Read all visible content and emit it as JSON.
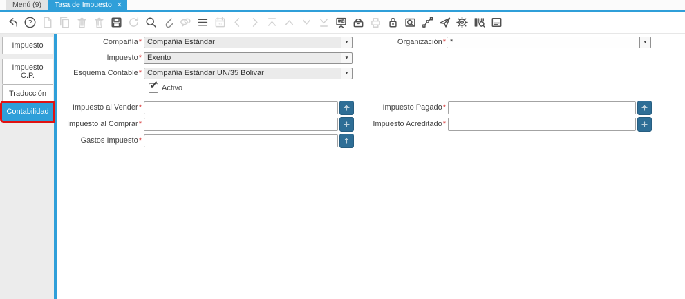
{
  "window": {
    "tab_menu": "Menú (9)",
    "tab_active": "Tasa de Impuesto"
  },
  "ui": {
    "close_glyph": "✕",
    "dropdown_arrow": "▼",
    "required_mark": "*",
    "check_glyph": "✓"
  },
  "colors": {
    "accent_blue": "#2f9fd9",
    "highlight_red": "#e01212",
    "account_button_blue": "#2e6e96",
    "readonly_field_gray": "#ebebeb"
  },
  "toolbar": {
    "items": [
      {
        "name": "undo-icon",
        "icon": "undo",
        "tone": "dk"
      },
      {
        "name": "help-icon",
        "icon": "help",
        "tone": "dk"
      },
      {
        "name": "new-record-icon",
        "icon": "newdoc",
        "tone": "lt"
      },
      {
        "name": "copy-record-icon",
        "icon": "copy",
        "tone": "lt"
      },
      {
        "name": "delete-record-icon",
        "icon": "trash",
        "tone": "lt"
      },
      {
        "name": "delete-selection-icon",
        "icon": "trash",
        "tone": "lt"
      },
      {
        "name": "save-icon",
        "icon": "save",
        "tone": "dk"
      },
      {
        "name": "refresh-icon",
        "icon": "refresh",
        "tone": "lt"
      },
      {
        "name": "find-icon",
        "icon": "find",
        "tone": "dk"
      },
      {
        "name": "attachment-icon",
        "icon": "attach",
        "tone": "md"
      },
      {
        "name": "chat-icon",
        "icon": "chat",
        "tone": "lt"
      },
      {
        "name": "grid-toggle-icon",
        "icon": "lines",
        "tone": "dk"
      },
      {
        "name": "calendar-icon",
        "icon": "calendar",
        "tone": "lt"
      },
      {
        "name": "previous-record-icon",
        "icon": "prev",
        "tone": "lt"
      },
      {
        "name": "next-record-icon",
        "icon": "next",
        "tone": "lt"
      },
      {
        "name": "first-record-icon",
        "icon": "first",
        "tone": "lt"
      },
      {
        "name": "parent-record-icon",
        "icon": "up",
        "tone": "lt"
      },
      {
        "name": "detail-record-icon",
        "icon": "down",
        "tone": "lt"
      },
      {
        "name": "last-record-icon",
        "icon": "last",
        "tone": "lt"
      },
      {
        "name": "report-icon",
        "icon": "board",
        "tone": "dk"
      },
      {
        "name": "archive-icon",
        "icon": "archive",
        "tone": "dk"
      },
      {
        "name": "print-icon",
        "icon": "print",
        "tone": "lt"
      },
      {
        "name": "lock-icon",
        "icon": "lock",
        "tone": "dk"
      },
      {
        "name": "zoom-across-icon",
        "icon": "zoomwin",
        "tone": "dk"
      },
      {
        "name": "workflow-icon",
        "icon": "flow",
        "tone": "dk"
      },
      {
        "name": "request-send-icon",
        "icon": "plane",
        "tone": "dk"
      },
      {
        "name": "process-gear-icon",
        "icon": "gear",
        "tone": "dk"
      },
      {
        "name": "product-info-icon",
        "icon": "barcode",
        "tone": "dk"
      },
      {
        "name": "window-customization-icon",
        "icon": "panel",
        "tone": "dk"
      }
    ]
  },
  "sidebar": {
    "tabs": [
      {
        "id": "impuesto",
        "label": "Impuesto",
        "selected": false,
        "highlighted": false
      },
      {
        "id": "impuesto-cp",
        "label": "Impuesto C.P.",
        "selected": false,
        "highlighted": false
      },
      {
        "id": "traduccion",
        "label": "Traducción",
        "selected": false,
        "highlighted": false
      },
      {
        "id": "contabilidad",
        "label": "Contabilidad",
        "selected": true,
        "highlighted": true
      }
    ]
  },
  "form": {
    "compania": {
      "label": "Compañía",
      "value": "Compañía Estándar",
      "required": true,
      "readonly": true
    },
    "organizacion": {
      "label": "Organización",
      "value": "*",
      "required": true,
      "readonly": false
    },
    "impuesto": {
      "label": "Impuesto",
      "value": "Exento",
      "required": true,
      "readonly": true
    },
    "esquema_contable": {
      "label": "Esquema Contable",
      "value": "Compañía Estándar UN/35 Bolivar",
      "required": true,
      "readonly": true
    },
    "activo": {
      "label": "Activo",
      "checked": true
    },
    "impuesto_al_vender": {
      "label": "Impuesto al Vender",
      "value": "",
      "required": true
    },
    "impuesto_pagado": {
      "label": "Impuesto Pagado",
      "value": "",
      "required": true
    },
    "impuesto_al_comprar": {
      "label": "Impuesto al Comprar",
      "value": "",
      "required": true
    },
    "impuesto_acreditado": {
      "label": "Impuesto Acreditado",
      "value": "",
      "required": true
    },
    "gastos_impuesto": {
      "label": "Gastos Impuesto",
      "value": "",
      "required": true
    }
  }
}
